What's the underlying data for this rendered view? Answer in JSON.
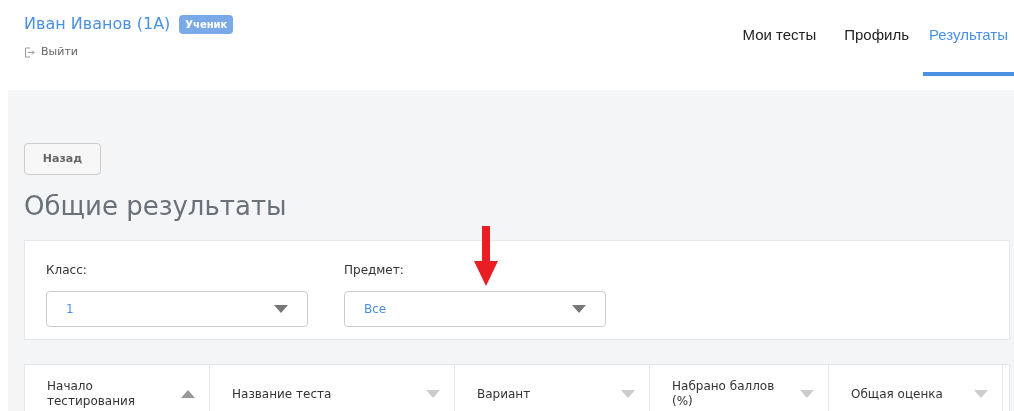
{
  "user": {
    "name": "Иван Иванов (1А)",
    "role_badge": "Ученик",
    "logout": "Выйти"
  },
  "nav": [
    {
      "label": "Мои тесты",
      "selected": false
    },
    {
      "label": "Профиль",
      "selected": false
    },
    {
      "label": "Результаты",
      "selected": true
    }
  ],
  "back_button": "Назад",
  "title": "Общие результаты",
  "filters": [
    {
      "label": "Класс:",
      "value": "1"
    },
    {
      "label": "Предмет:",
      "value": "Все"
    }
  ],
  "pointer_arrow": {
    "shown": true
  },
  "table": {
    "columns": [
      {
        "label": "Начало тестирования",
        "sort_active": true
      },
      {
        "label": "Название теста",
        "sort_active": false
      },
      {
        "label": "Вариант",
        "sort_active": false
      },
      {
        "label": "Набрано баллов (%)",
        "sort_active": false
      },
      {
        "label": "Общая оценка",
        "sort_active": false
      }
    ]
  }
}
